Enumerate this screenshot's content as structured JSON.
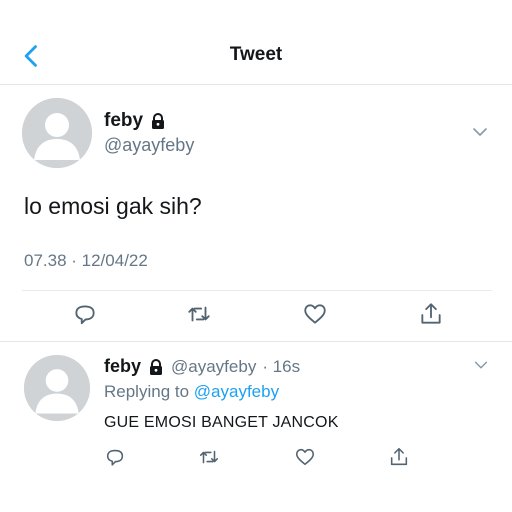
{
  "header": {
    "title": "Tweet"
  },
  "tweet": {
    "author_name": "feby",
    "author_handle": "@ayayfeby",
    "text": "lo emosi gak sih?",
    "timestamp": "07.38 · 12/04/22"
  },
  "reply": {
    "author_name": "feby",
    "author_handle": "@ayayfeby",
    "age": "· 16s",
    "replying_prefix": "Replying to",
    "replying_handle": "@ayayfeby",
    "text": "GUE EMOSI BANGET JANCOK"
  },
  "icons": {
    "back": "chevron-left-icon",
    "lock": "lock-icon",
    "more": "chevron-down-icon",
    "reply": "reply-icon",
    "retweet": "retweet-icon",
    "like": "heart-icon",
    "share": "share-icon"
  },
  "colors": {
    "accent": "#1da1f2",
    "secondary_text": "#657786",
    "divider": "#e1e8ed"
  }
}
